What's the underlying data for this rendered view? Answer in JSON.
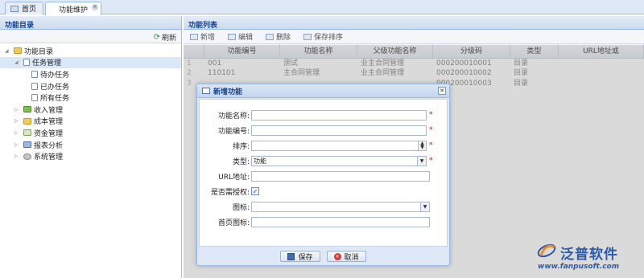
{
  "tabs": [
    {
      "label": "首页"
    },
    {
      "label": "功能维护"
    }
  ],
  "left": {
    "title": "功能目录",
    "refresh_label": "刷新",
    "tree": [
      {
        "label": "功能目录"
      },
      {
        "label": "任务管理"
      },
      {
        "label": "待办任务"
      },
      {
        "label": "已办任务"
      },
      {
        "label": "所有任务"
      },
      {
        "label": "收入管理"
      },
      {
        "label": "成本管理"
      },
      {
        "label": "资金管理"
      },
      {
        "label": "报表分析"
      },
      {
        "label": "系统管理"
      }
    ]
  },
  "right": {
    "title": "功能列表",
    "toolbar": {
      "add": "新增",
      "edit": "编辑",
      "delete": "删除",
      "save_order": "保存排序"
    },
    "columns": [
      "功能编号",
      "功能名称",
      "父级功能名称",
      "分级码",
      "类型",
      "URL地址或"
    ],
    "rows": [
      {
        "idx": "1",
        "code": "001",
        "name": "测试",
        "parent": "业主合同管理",
        "level": "000200010001",
        "type": "目录"
      },
      {
        "idx": "2",
        "code": "110101",
        "name": "主合同管理",
        "parent": "业主合同管理",
        "level": "000200010002",
        "type": "目录"
      },
      {
        "idx": "3",
        "code": "",
        "name": "",
        "parent": "",
        "level": "000200010003",
        "type": "目录"
      }
    ]
  },
  "dialog": {
    "title": "新增功能",
    "fields": {
      "name_label": "功能名称:",
      "code_label": "功能编号:",
      "order_label": "排序:",
      "type_label": "类型:",
      "type_value": "功能",
      "url_label": "URL地址:",
      "auth_label": "是否需授权:",
      "icon_label": "图标:",
      "home_icon_label": "首页图标:"
    },
    "required_mark": "*",
    "auth_checked": true,
    "save_label": "保存",
    "cancel_label": "取消"
  },
  "logo": {
    "brand": "泛普软件",
    "url": "www.fanpusoft.com"
  }
}
